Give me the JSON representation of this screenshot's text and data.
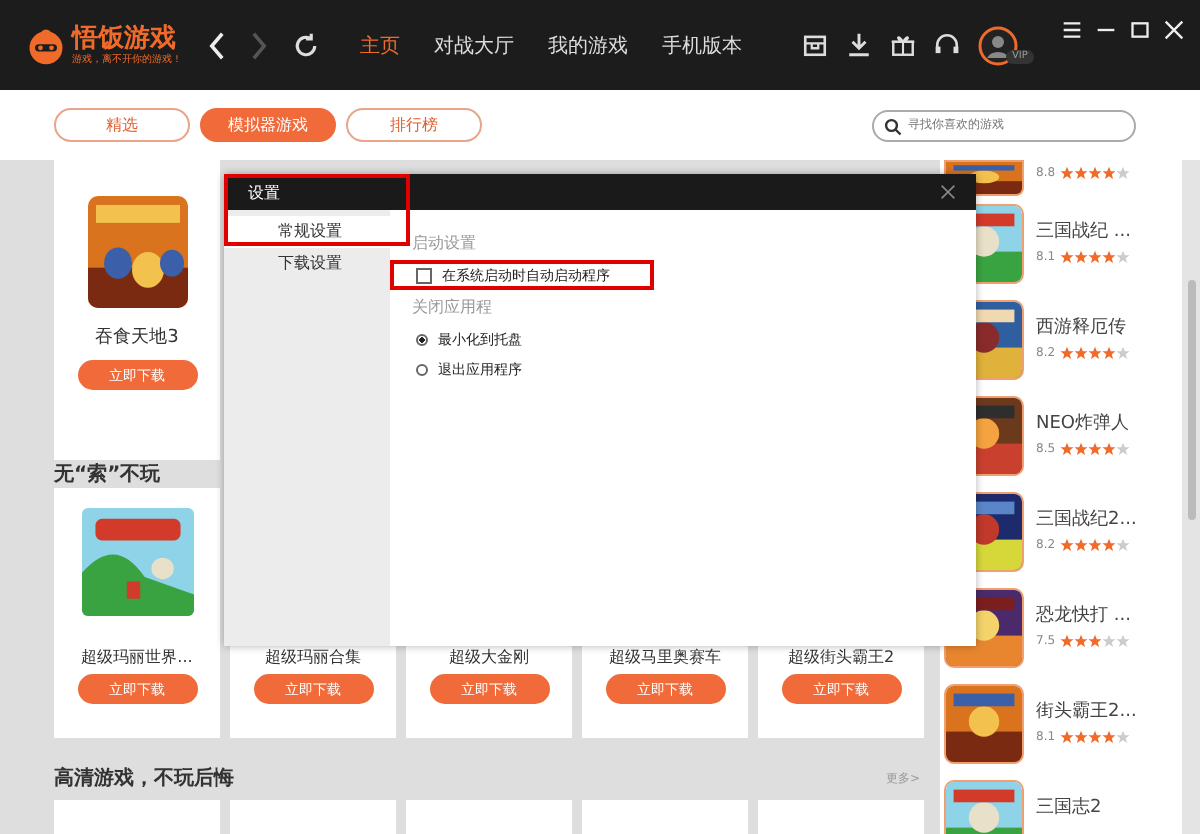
{
  "header": {
    "logo": {
      "name": "悟饭游戏",
      "slogan": "游戏，离不开你的游戏！"
    },
    "history": [
      {
        "kind": "back",
        "disabled": false
      },
      {
        "kind": "forward",
        "disabled": true
      }
    ],
    "nav": [
      {
        "label": "主页",
        "selected": true
      },
      {
        "label": "对战大厅",
        "selected": false
      },
      {
        "label": "我的游戏",
        "selected": false
      },
      {
        "label": "手机版本",
        "selected": false
      }
    ],
    "avatar_badge": "VIP"
  },
  "tabs": [
    {
      "label": "精选",
      "selected": false
    },
    {
      "label": "模拟器游戏",
      "selected": true
    },
    {
      "label": "排行榜",
      "selected": false
    }
  ],
  "search": {
    "placeholder": "寻找你喜欢的游戏"
  },
  "featured_cards": [
    {
      "name": "吞食天地3",
      "button": "立即下载"
    }
  ],
  "sections": [
    {
      "title": "无“索”不玩",
      "cards": [
        {
          "kind": "game",
          "name": "超级玛丽世界...",
          "button": "立即下载"
        },
        {
          "kind": "covered",
          "name": "超级玛丽合集",
          "button": "立即下载"
        },
        {
          "kind": "covered",
          "name": "超级大金刚",
          "button": "立即下载"
        },
        {
          "kind": "covered",
          "name": "超级马里奥赛车",
          "button": "立即下载"
        },
        {
          "kind": "covered",
          "name": "超级街头霸王2",
          "button": "立即下载"
        }
      ]
    },
    {
      "title": "高清游戏，不玩后悔",
      "more": "更多>",
      "cards": [
        {
          "kind": "cut"
        },
        {
          "kind": "cut"
        },
        {
          "kind": "cut"
        },
        {
          "kind": "cut"
        },
        {
          "kind": "cut"
        }
      ]
    }
  ],
  "ranking": [
    {
      "kind": "cut-top",
      "score": "8.8",
      "stars": 4
    },
    {
      "kind": "full",
      "name": "三国战纪 ...",
      "score": "8.1",
      "stars": 4
    },
    {
      "kind": "full",
      "name": "西游释厄传",
      "score": "8.2",
      "stars": 4
    },
    {
      "kind": "full",
      "name": "NEO炸弹人",
      "score": "8.5",
      "stars": 4
    },
    {
      "kind": "full",
      "name": "三国战纪2...",
      "score": "8.2",
      "stars": 4
    },
    {
      "kind": "full",
      "name": "恐龙快打 ...",
      "score": "7.5",
      "stars": 3
    },
    {
      "kind": "full",
      "name": "街头霸王2...",
      "score": "8.1",
      "stars": 4
    },
    {
      "kind": "cut-bottom",
      "name": "三国志2"
    }
  ],
  "settings_dialog": {
    "title": "设置",
    "menu": [
      {
        "label": "常规设置",
        "selected": true,
        "highlighted": true
      },
      {
        "label": "下载设置",
        "selected": false,
        "highlighted": false
      }
    ],
    "groups": [
      {
        "title": "启动设置",
        "options": [
          {
            "kind": "checkbox",
            "label": "在系统启动时自动启动程序",
            "checked": false,
            "highlighted": true
          }
        ]
      },
      {
        "title": "关闭应用程",
        "options": [
          {
            "kind": "radio",
            "label": "最小化到托盘",
            "checked": true,
            "highlighted": false
          },
          {
            "kind": "radio",
            "label": "退出应用程序",
            "checked": false,
            "highlighted": false
          }
        ]
      }
    ]
  }
}
